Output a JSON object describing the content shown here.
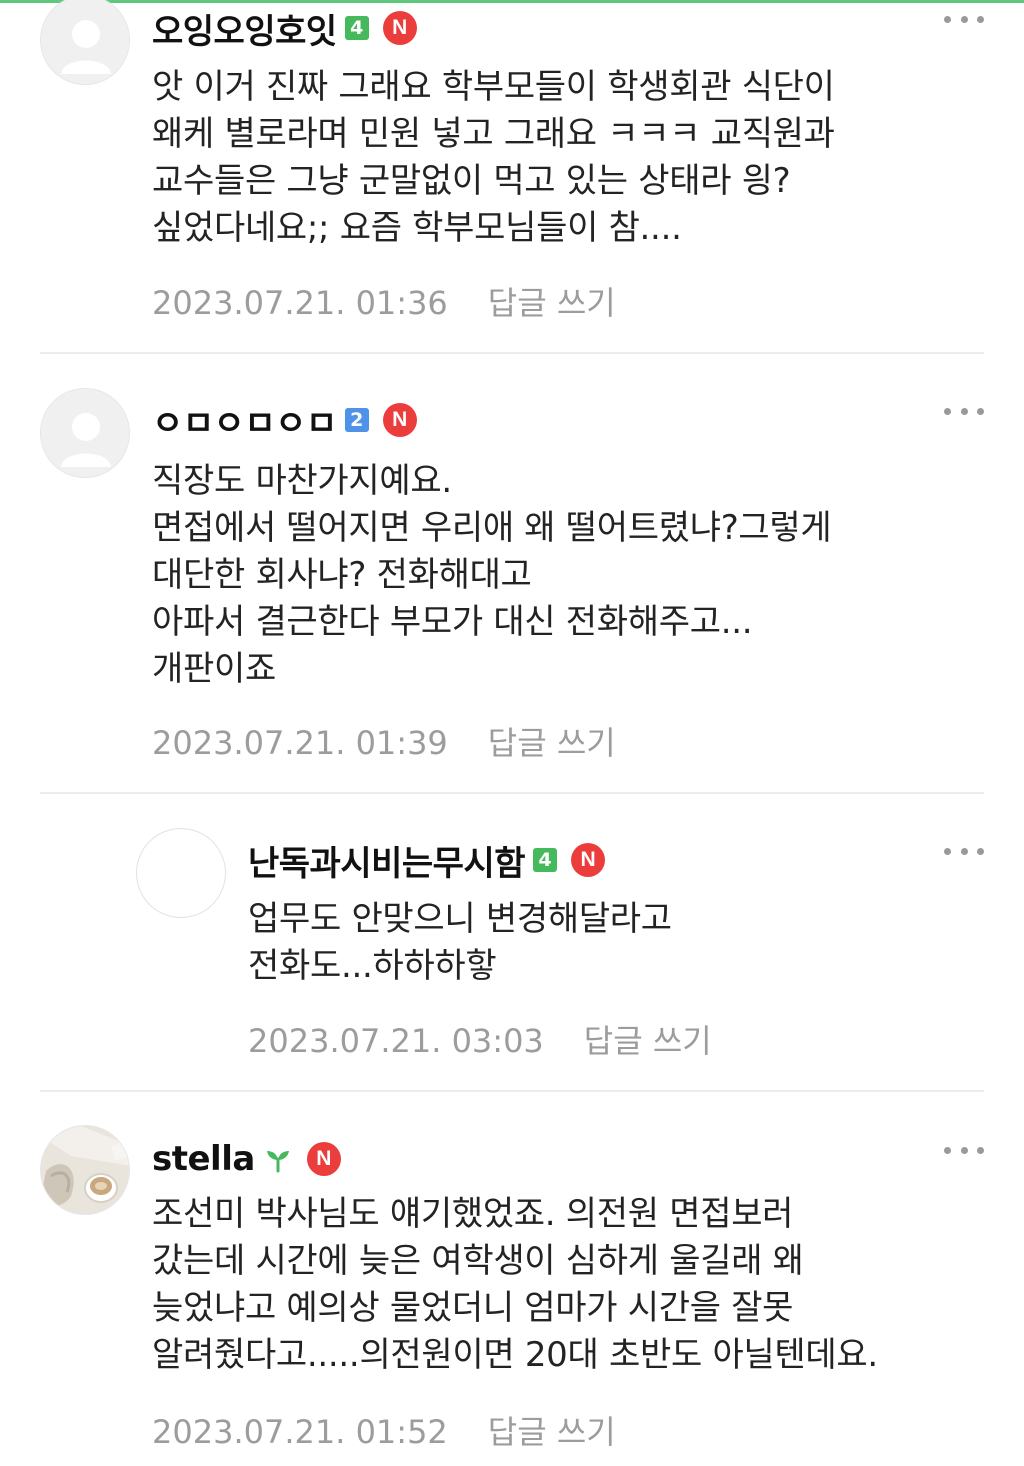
{
  "comments": [
    {
      "nickname": "오잉오잉호잇",
      "level": "4",
      "new_badge": "N",
      "lines": [
        "앗 이거 진짜 그래요 학부모들이 학생회관 식단이",
        "왜케 별로라며 민원 넣고 그래요 ㅋㅋㅋ 교직원과",
        "교수들은 그냥 군말없이 먹고 있는 상태라 읭?",
        "싶었다네요;; 요즘 학부모님들이 참...."
      ],
      "date": "2023.07.21. 01:36",
      "reply_label": "답글 쓰기"
    },
    {
      "nickname": "ㅇㅁㅇㅁㅇㅁ",
      "level": "2",
      "new_badge": "N",
      "lines": [
        "직장도 마찬가지예요.",
        "면접에서 떨어지면 우리애 왜 떨어트렸냐?그렇게",
        "대단한 회사냐? 전화해대고",
        "아파서 결근한다 부모가 대신 전화해주고...",
        "개판이죠"
      ],
      "date": "2023.07.21. 01:39",
      "reply_label": "답글 쓰기"
    },
    {
      "nickname": "난독과시비는무시함",
      "level": "4",
      "new_badge": "N",
      "lines": [
        "업무도 안맞으니 변경해달라고",
        "전화도...하하하핳"
      ],
      "date": "2023.07.21. 03:03",
      "reply_label": "답글 쓰기"
    },
    {
      "nickname": "stella",
      "new_badge": "N",
      "lines": [
        "조선미 박사님도 얘기했었죠. 의전원 면접보러",
        "갔는데 시간에 늦은 여학생이 심하게 울길래 왜",
        "늦었냐고 예의상 물었더니 엄마가 시간을 잘못",
        "알려줬다고.....의전원이면 20대 초반도 아닐텐데요."
      ],
      "date": "2023.07.21. 01:52",
      "reply_label": "답글 쓰기"
    }
  ],
  "icons": {
    "default_avatar": "person-silhouette-icon",
    "photo_avatar": "coffee-cup-photo",
    "sprout": "sprout-icon",
    "more": "more-dots-icon"
  },
  "colors": {
    "level_green": "#47b95d",
    "level_blue": "#4f92ea",
    "new_badge": "#ec3d3d",
    "meta_text": "#9c9c9c",
    "accent": "#5ec97d"
  }
}
